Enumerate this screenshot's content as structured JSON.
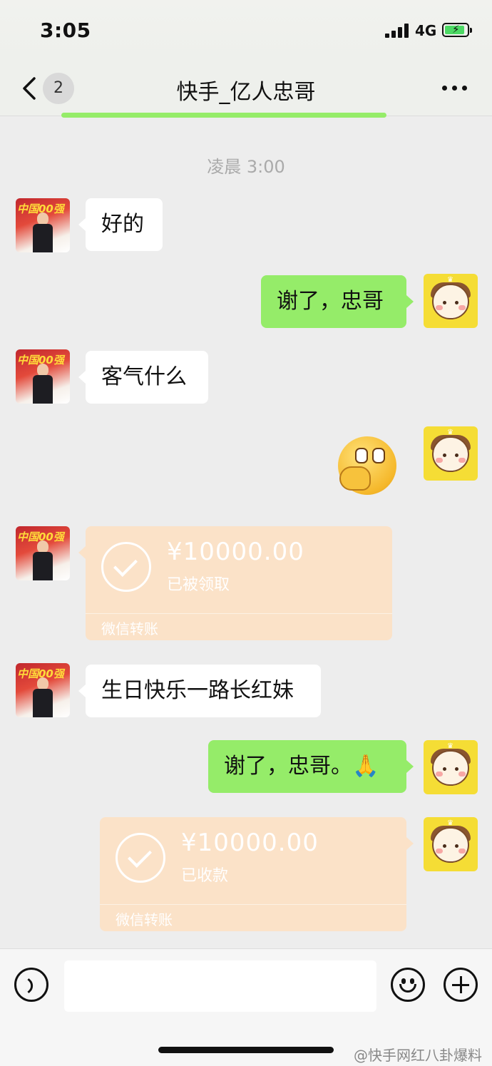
{
  "status_bar": {
    "time": "3:05",
    "network": "4G"
  },
  "nav": {
    "unread_count": "2",
    "title": "快手_亿人忠哥"
  },
  "chat": {
    "timestamp": "凌晨 3:00",
    "messages": [
      {
        "side": "left",
        "text": "好的"
      },
      {
        "side": "right",
        "text": "谢了，忠哥"
      },
      {
        "side": "left",
        "text": "客气什么"
      },
      {
        "side": "right",
        "type": "sticker",
        "icon": "covering-mouth-emoji-sticker"
      },
      {
        "side": "left",
        "type": "transfer",
        "amount": "¥10000.00",
        "status": "已被领取",
        "brand": "微信转账"
      },
      {
        "side": "left",
        "text": "生日快乐一路长红妹"
      },
      {
        "side": "right",
        "text": "谢了，忠哥。🙏"
      },
      {
        "side": "right",
        "type": "transfer",
        "amount": "¥10000.00",
        "status": "已收款",
        "brand": "微信转账"
      }
    ]
  },
  "avatars": {
    "left_logo": "中国00强"
  },
  "input_bar": {
    "placeholder": ""
  },
  "watermark": "@快手网红八卦爆料",
  "colors": {
    "chat_background": "#ededed",
    "bubble_right": "#95ec69",
    "bubble_left": "#ffffff",
    "transfer_card": "#fbe2c8"
  }
}
